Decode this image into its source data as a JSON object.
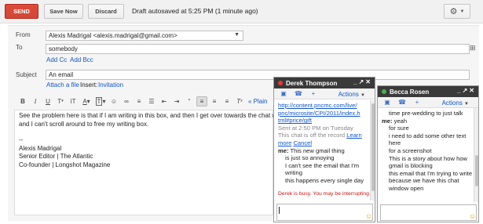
{
  "toolbar": {
    "send_label": "SEND",
    "save_label": "Save Now",
    "discard_label": "Discard",
    "draft_status": "Draft autosaved at 5:25 PM (1 minute ago)"
  },
  "compose": {
    "from_label": "From",
    "from_value": "Alexis Madrigal <alexis.madrigal@gmail.com>",
    "to_label": "To",
    "to_value": "somebody",
    "add_cc": "Add Cc",
    "add_bcc": "Add Bcc",
    "subject_label": "Subject",
    "subject_value": "An email",
    "attach": "Attach a file",
    "insert": "Insert:",
    "invitation": "Invitation",
    "plain": "« Plain",
    "body_lines": [
      "See the problem here is that if I am writing in this box, and then I get over towards the chat window",
      "and I can't scroll around to free my writing box.",
      "",
      "--",
      "Alexis Madrigal",
      "Senior Editor | The Atlantic",
      "Co-founder | Longshot Magazine"
    ]
  },
  "chat1": {
    "name": "Derek Thompson",
    "actions": "Actions",
    "status_color": "#e53935",
    "log": {
      "link1": "http://content.pncmc.com/live/",
      "link2": "pnc/microsite/CPI/2011/index.h",
      "link3": "tml#price/gift",
      "sent_at": "Sent at 2:50 PM on Tuesday",
      "offrecord": "This chat is off the record",
      "learn": "Learn",
      "more": "more",
      "cancel": "Cancel",
      "me_label": "me:",
      "m1": "This new gmail thing",
      "m2": "is just so annoying",
      "m3": "I can't see the email that I'm",
      "m4": "writing",
      "m5": "this happens every single day",
      "busy": "Derek is busy. You may be interrupting."
    }
  },
  "chat2": {
    "name": "Becca Rosen",
    "actions": "Actions",
    "status_color": "#4caf50",
    "log": {
      "l0": "time pre-wedding to just talk",
      "me_label": "me:",
      "l1": "yeah",
      "l2": "for sure",
      "l3": "i need to add some other text",
      "l4": "here",
      "l5": "for a screenshot",
      "l6": "This is a story about how how",
      "l7": "gmail is blocking",
      "l8": "this email that I'm trying to write",
      "l9": "because we have this chat",
      "l10": "window open"
    }
  }
}
